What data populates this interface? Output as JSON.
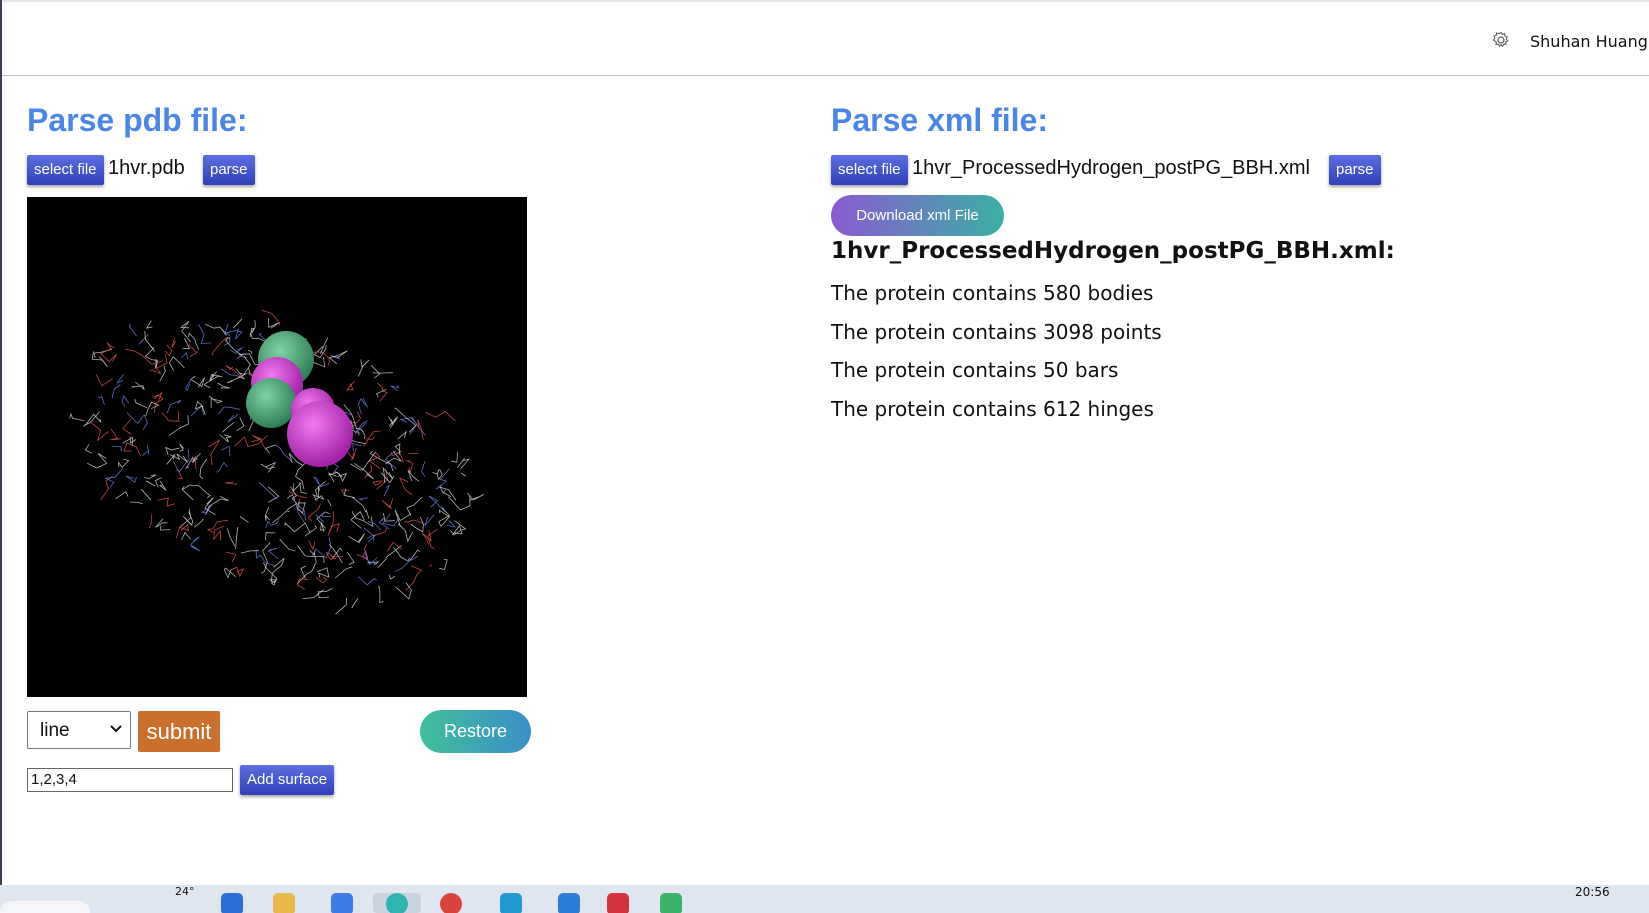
{
  "header": {
    "username": "Shuhan Huang"
  },
  "pdb": {
    "title": "Parse pdb file:",
    "select_label": "select file",
    "filename": "1hvr.pdb",
    "parse_label": "parse",
    "mode_value": "line",
    "submit_label": "submit",
    "restore_label": "Restore",
    "surface_input_value": "1,2,3,4",
    "add_surface_label": "Add surface"
  },
  "xml": {
    "title": "Parse xml file:",
    "select_label": "select file",
    "filename": "1hvr_ProcessedHydrogen_postPG_BBH.xml",
    "parse_label": "parse",
    "download_label": "Download xml File",
    "heading": "1hvr_ProcessedHydrogen_postPG_BBH.xml:",
    "stats": [
      "The protein contains 580 bodies",
      "The protein contains 3098 points",
      "The protein contains 50 bars",
      "The protein contains 612 hinges"
    ]
  },
  "taskbar": {
    "temperature": "24°",
    "time": "20:56"
  },
  "colors": {
    "title_blue": "#4a86e8",
    "button_blue": "#3447c4",
    "submit_orange": "#c9702c",
    "sphere_green": "#4fa87a",
    "sphere_magenta": "#cc33cc"
  }
}
